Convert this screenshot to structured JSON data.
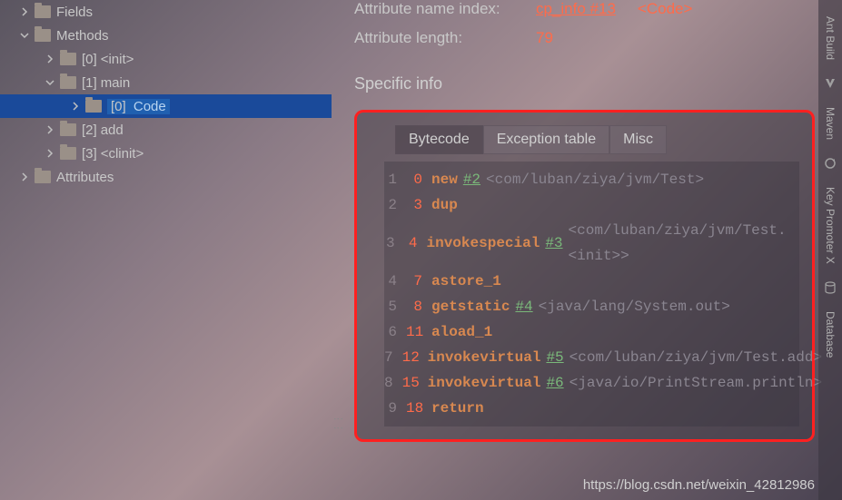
{
  "tree": {
    "fields": {
      "label": "Fields"
    },
    "methods": {
      "label": "Methods",
      "items": [
        {
          "idx": "[0]",
          "name": "<init>"
        },
        {
          "idx": "[1]",
          "name": "main",
          "children": [
            {
              "idx": "[0]",
              "name": "Code"
            }
          ]
        },
        {
          "idx": "[2]",
          "name": "add"
        },
        {
          "idx": "[3]",
          "name": "<clinit>"
        }
      ]
    },
    "attributes": {
      "label": "Attributes"
    }
  },
  "attrs": {
    "name_label": "Attribute name index:",
    "name_link": "cp_info #13",
    "name_tag": "<Code>",
    "length_label": "Attribute length:",
    "length_value": "79"
  },
  "section": {
    "title": "Specific info"
  },
  "tabs": {
    "bytecode": "Bytecode",
    "exception": "Exception table",
    "misc": "Misc"
  },
  "bytecode": [
    {
      "n": "1",
      "off": "0",
      "op": "new",
      "ref": "#2",
      "cmt": "<com/luban/ziya/jvm/Test>"
    },
    {
      "n": "2",
      "off": "3",
      "op": "dup",
      "ref": "",
      "cmt": ""
    },
    {
      "n": "3",
      "off": "4",
      "op": "invokespecial",
      "ref": "#3",
      "cmt": "<com/luban/ziya/jvm/Test.<init>>"
    },
    {
      "n": "4",
      "off": "7",
      "op": "astore_1",
      "ref": "",
      "cmt": ""
    },
    {
      "n": "5",
      "off": "8",
      "op": "getstatic",
      "ref": "#4",
      "cmt": "<java/lang/System.out>"
    },
    {
      "n": "6",
      "off": "11",
      "op": "aload_1",
      "ref": "",
      "cmt": ""
    },
    {
      "n": "7",
      "off": "12",
      "op": "invokevirtual",
      "ref": "#5",
      "cmt": "<com/luban/ziya/jvm/Test.add>"
    },
    {
      "n": "8",
      "off": "15",
      "op": "invokevirtual",
      "ref": "#6",
      "cmt": "<java/io/PrintStream.println>"
    },
    {
      "n": "9",
      "off": "18",
      "op": "return",
      "ref": "",
      "cmt": ""
    }
  ],
  "right_tabs": {
    "ant": "Ant Build",
    "maven": "Maven",
    "kpx": "Key Promoter X",
    "db": "Database"
  },
  "watermark": "https://blog.csdn.net/weixin_42812986"
}
